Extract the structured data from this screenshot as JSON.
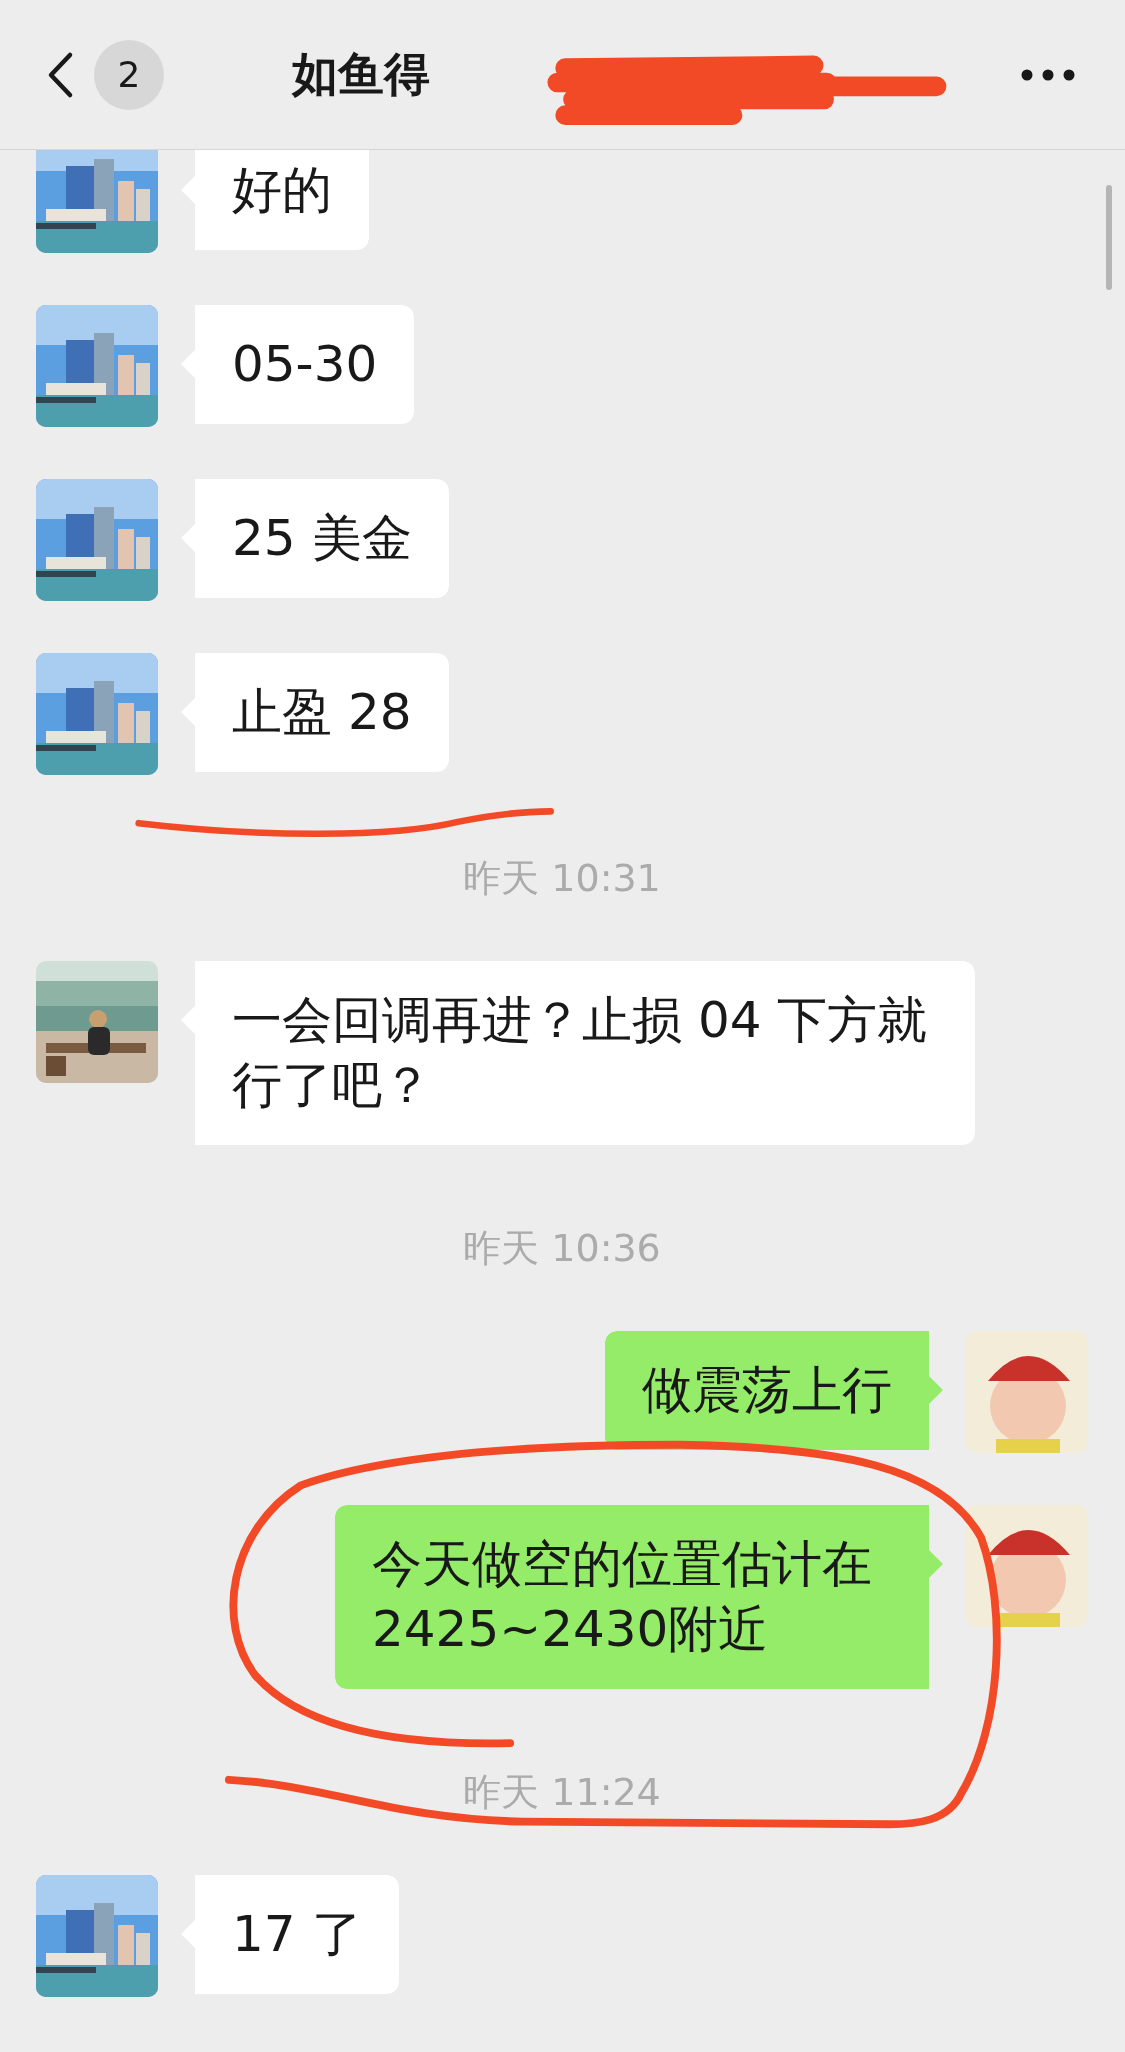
{
  "header": {
    "back_badge": "2",
    "title": "如鱼得"
  },
  "messages": [
    {
      "kind": "message",
      "outgoing": false,
      "text": "好的"
    },
    {
      "kind": "message",
      "outgoing": false,
      "text": "05-30"
    },
    {
      "kind": "message",
      "outgoing": false,
      "text": "25 美金"
    },
    {
      "kind": "message",
      "outgoing": false,
      "text": "止盈 28"
    },
    {
      "kind": "time",
      "text": "昨天 10:31"
    },
    {
      "kind": "message",
      "outgoing": false,
      "text": "一会回调再进？止损 04 下方就行了吧？"
    },
    {
      "kind": "time",
      "text": "昨天 10:36"
    },
    {
      "kind": "message",
      "outgoing": true,
      "text": "做震荡上行"
    },
    {
      "kind": "message",
      "outgoing": true,
      "text": "今天做空的位置估计在2425~2430附近"
    },
    {
      "kind": "time",
      "text": "昨天 11:24"
    },
    {
      "kind": "message",
      "outgoing": false,
      "text": "17 了"
    }
  ]
}
